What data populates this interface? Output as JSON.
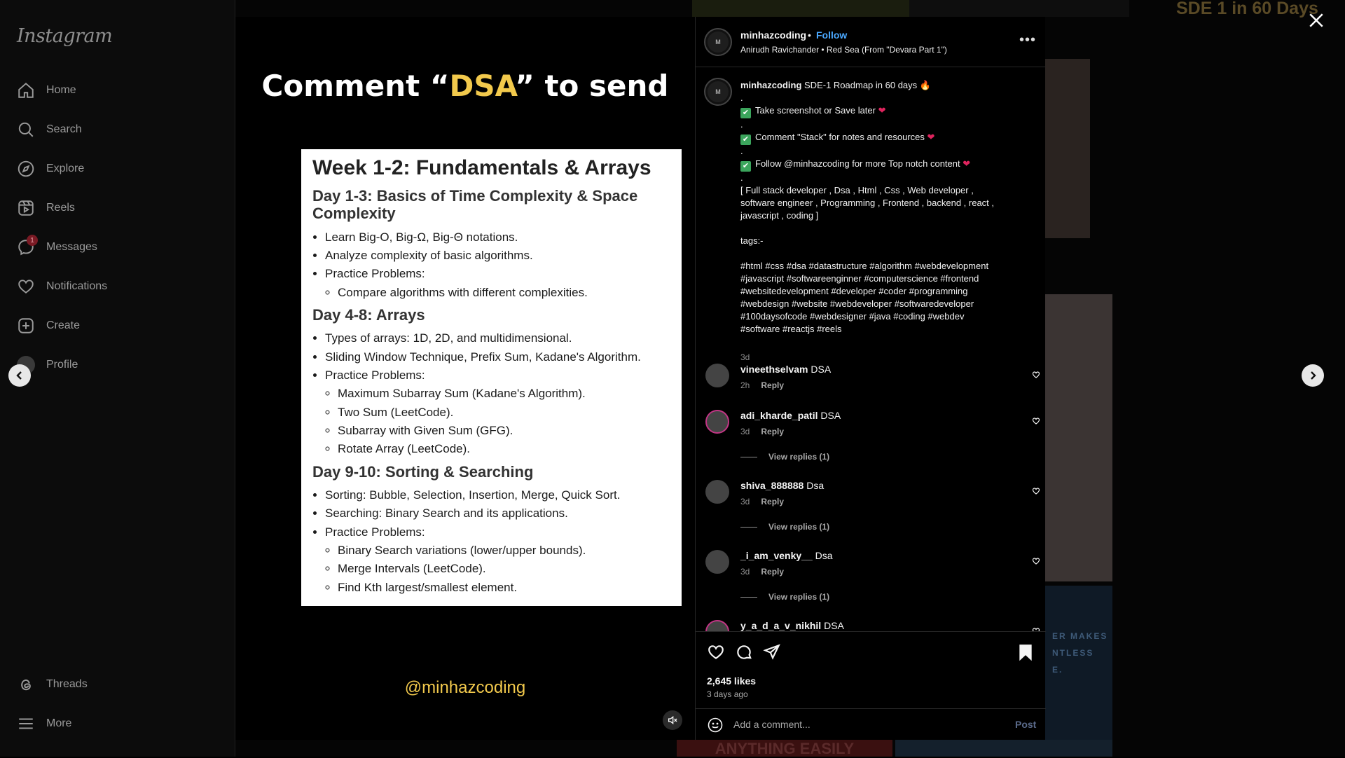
{
  "sidebar": {
    "logo": "Instagram",
    "items": [
      {
        "label": "Home"
      },
      {
        "label": "Search"
      },
      {
        "label": "Explore"
      },
      {
        "label": "Reels"
      },
      {
        "label": "Messages",
        "badge": "1"
      },
      {
        "label": "Notifications"
      },
      {
        "label": "Create"
      },
      {
        "label": "Profile"
      }
    ],
    "bottom": [
      {
        "label": "Threads"
      },
      {
        "label": "More"
      }
    ]
  },
  "background": {
    "banner_text": "SDE 1 in 60 Days",
    "bottom_tile_text": "ANYTHING EASILY",
    "side_tile_text": "ER MAKES\nNTLESS\nE."
  },
  "media": {
    "headline_pre": "Comment “",
    "headline_hl": "DSA",
    "headline_post": "” to send",
    "slide": {
      "title": "Week 1-2: Fundamentals & Arrays",
      "sections": [
        {
          "heading": "Day 1-3: Basics of Time Complexity & Space Complexity",
          "items": [
            {
              "text": "Learn Big-O, Big-Ω, Big-Θ notations."
            },
            {
              "text": "Analyze complexity of basic algorithms."
            },
            {
              "text": "Practice Problems:",
              "sub": [
                "Compare algorithms with different complexities."
              ]
            }
          ]
        },
        {
          "heading": "Day 4-8: Arrays",
          "items": [
            {
              "text": "Types of arrays: 1D, 2D, and multidimensional."
            },
            {
              "text": "Sliding Window Technique, Prefix Sum, Kadane's Algorithm."
            },
            {
              "text": "Practice Problems:",
              "sub": [
                "Maximum Subarray Sum (Kadane's Algorithm).",
                "Two Sum (LeetCode).",
                "Subarray with Given Sum (GFG).",
                "Rotate Array (LeetCode)."
              ]
            }
          ]
        },
        {
          "heading": "Day 9-10: Sorting & Searching",
          "items": [
            {
              "text": "Sorting: Bubble, Selection, Insertion, Merge, Quick Sort."
            },
            {
              "text": "Searching: Binary Search and its applications."
            },
            {
              "text": "Practice Problems:",
              "sub": [
                "Binary Search variations (lower/upper bounds).",
                "Merge Intervals (LeetCode).",
                "Find Kth largest/smallest element."
              ]
            }
          ]
        }
      ]
    },
    "watermark": "@minhazcoding"
  },
  "post": {
    "username": "minhazcoding",
    "separator": "•",
    "follow_label": "Follow",
    "music": "Anirudh Ravichander • Red Sea (From \"Devara Part 1\")",
    "more_label": "•••",
    "caption": {
      "username": "minhazcoding",
      "first_line": "SDE-1 Roadmap in 60 days 🔥",
      "lines": [
        ".",
        "CHECK|Take screenshot or Save later",
        ".",
        "CHECK|Comment \"Stack\" for notes and resources",
        ".",
        "CHECK|Follow @minhazcoding for more Top notch content",
        ".",
        "[ Full stack developer , Dsa , Html , Css , Web developer ,",
        "software engineer , Programming , Frontend , backend , react ,",
        "javascript , coding ]",
        "",
        "tags:-",
        "",
        "#html #css #dsa #datastructure  #algorithm #webdevelopment",
        "#javascript #softwareenginner #computerscience #frontend",
        "#websitedevelopment #developer #coder #programming",
        "#webdesign #website #webdeveloper #softwaredeveloper",
        "#100daysofcode  #webdesigner #java #coding #webdev",
        "#software #reactjs #reels"
      ],
      "time": "3d"
    },
    "comments": [
      {
        "user": "vineethselvam",
        "text": "DSA",
        "time": "2h",
        "reply": "Reply",
        "view_replies": ""
      },
      {
        "user": "adi_kharde_patil",
        "text": "DSA",
        "time": "3d",
        "reply": "Reply",
        "view_replies": "View replies (1)"
      },
      {
        "user": "shiva_888888",
        "text": "Dsa",
        "time": "3d",
        "reply": "Reply",
        "view_replies": "View replies (1)"
      },
      {
        "user": "_i_am_venky__",
        "text": "Dsa",
        "time": "3d",
        "reply": "Reply",
        "view_replies": "View replies (1)"
      },
      {
        "user": "y_a_d_a_v_nikhil",
        "text": "DSA",
        "time": "",
        "reply": "",
        "view_replies": ""
      }
    ],
    "likes": "2,645 likes",
    "posted_ago": "3 days ago",
    "add_comment_placeholder": "Add a comment...",
    "post_label": "Post"
  },
  "colors": {
    "accent_link": "#4aa8ff",
    "highlight_yellow": "#f2c94c",
    "heart_red": "#e0245e"
  }
}
